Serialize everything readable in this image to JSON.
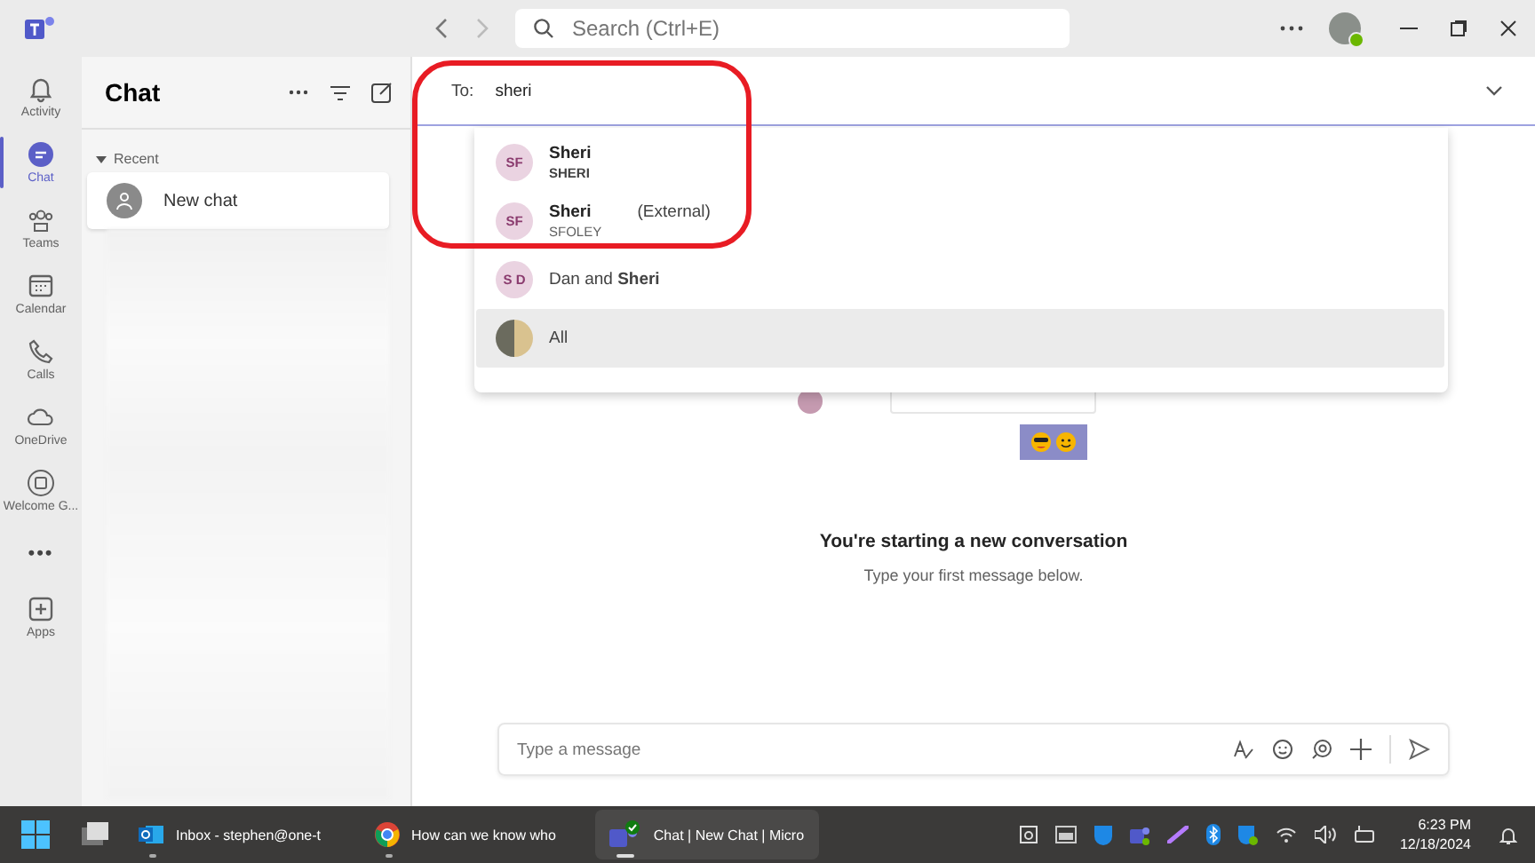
{
  "title_bar": {
    "search_placeholder": "Search (Ctrl+E)"
  },
  "app_bar": {
    "items": [
      {
        "kind": "bell",
        "label": "Activity",
        "selected": false
      },
      {
        "kind": "chat",
        "label": "Chat",
        "selected": true
      },
      {
        "kind": "teams",
        "label": "Teams",
        "selected": false
      },
      {
        "kind": "calendar",
        "label": "Calendar",
        "selected": false
      },
      {
        "kind": "calls",
        "label": "Calls",
        "selected": false
      },
      {
        "kind": "cloud",
        "label": "OneDrive",
        "selected": false
      },
      {
        "kind": "welcome",
        "label": "Welcome G...",
        "selected": false
      },
      {
        "kind": "more",
        "label": "•••",
        "selected": false
      },
      {
        "kind": "apps",
        "label": "Apps",
        "selected": false
      }
    ]
  },
  "chat_list": {
    "title": "Chat",
    "section": "Recent",
    "items": [
      {
        "name": "New chat",
        "selected": true
      }
    ]
  },
  "to_field": {
    "label": "To:",
    "value": "sheri"
  },
  "suggestions": [
    {
      "kind": "person",
      "initials": "SF",
      "name": "Sheri",
      "subtitle": "SHERI",
      "selected": false
    },
    {
      "kind": "person",
      "initials": "SF",
      "name": "Sheri",
      "tag": "(External)",
      "subtitle": "SFOLEY",
      "selected": false
    },
    {
      "kind": "pair",
      "initials": "S D",
      "text": "Dan and **Sheri**",
      "selected": false
    },
    {
      "kind": "photo",
      "text": "All",
      "selected": true
    }
  ],
  "empty_state": {
    "title": "You're starting a new conversation",
    "subtitle": "Type your first message below."
  },
  "compose": {
    "placeholder": "Type a message"
  },
  "taskbar": {
    "apps": [
      {
        "kind": "outlook",
        "label": "Inbox - stephen@one-t",
        "selected": false
      },
      {
        "kind": "chrome",
        "label": "How can we know who",
        "selected": false
      },
      {
        "kind": "teams",
        "label": "Chat | New Chat | Micro",
        "selected": true
      }
    ],
    "time": "6:23 PM",
    "date": "12/18/2024"
  }
}
